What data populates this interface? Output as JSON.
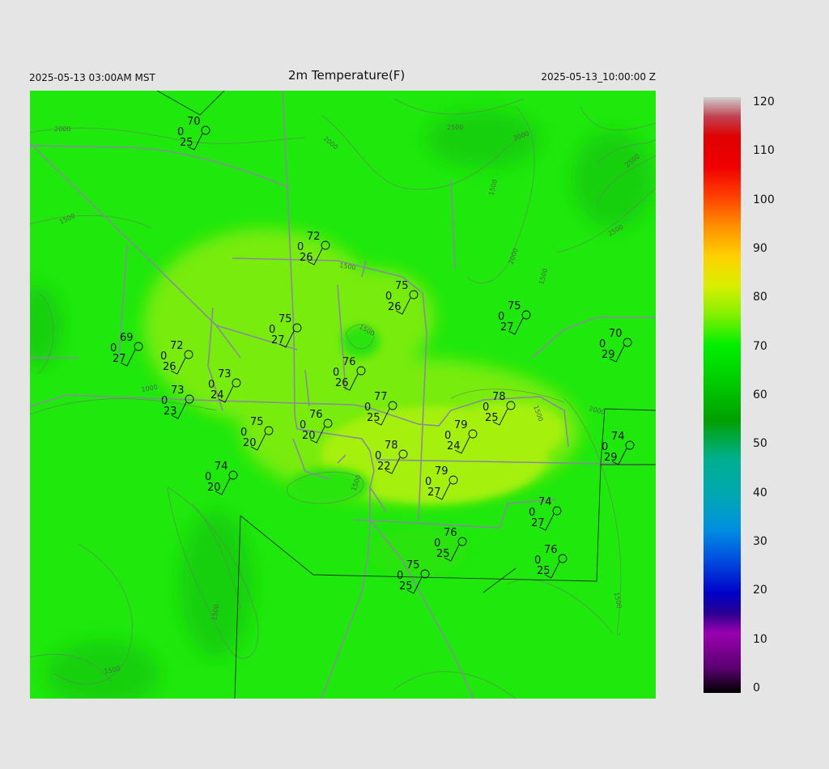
{
  "header": {
    "local_time": "2025-05-13 03:00AM MST",
    "title": "2m Temperature(F)",
    "utc_time": "2025-05-13_10:00:00 Z"
  },
  "colorbar": {
    "labels": [
      "120",
      "110",
      "100",
      "90",
      "80",
      "70",
      "60",
      "50",
      "40",
      "30",
      "20",
      "10",
      "0"
    ],
    "min": 0,
    "max": 120,
    "stops": [
      {
        "v": 0,
        "c": "#000000"
      },
      {
        "v": 5,
        "c": "#5a0070"
      },
      {
        "v": 12,
        "c": "#9a00b0"
      },
      {
        "v": 16,
        "c": "#2a0090"
      },
      {
        "v": 20,
        "c": "#0000c8"
      },
      {
        "v": 27,
        "c": "#0050e0"
      },
      {
        "v": 33,
        "c": "#0090e0"
      },
      {
        "v": 40,
        "c": "#00a8b0"
      },
      {
        "v": 47,
        "c": "#00b090"
      },
      {
        "v": 55,
        "c": "#00a000"
      },
      {
        "v": 62,
        "c": "#00c800"
      },
      {
        "v": 70,
        "c": "#00f000"
      },
      {
        "v": 76,
        "c": "#80f000"
      },
      {
        "v": 82,
        "c": "#d8f000"
      },
      {
        "v": 88,
        "c": "#ffd000"
      },
      {
        "v": 94,
        "c": "#ff9000"
      },
      {
        "v": 100,
        "c": "#ff4000"
      },
      {
        "v": 106,
        "c": "#f00000"
      },
      {
        "v": 112,
        "c": "#e00000"
      },
      {
        "v": 116,
        "c": "#c04050"
      },
      {
        "v": 120,
        "c": "#d0d0d0"
      }
    ]
  },
  "contour_labels": [
    "2000",
    "2000",
    "2500",
    "3000",
    "2500",
    "2500",
    "2000",
    "1500",
    "1500",
    "1500",
    "1500",
    "1000",
    "1500",
    "1500",
    "1500",
    "2000",
    "1500",
    "1500",
    "1500"
  ],
  "stations": [
    {
      "t": "70",
      "td": "25",
      "ws": "0"
    },
    {
      "t": "72",
      "td": "26",
      "ws": "0"
    },
    {
      "t": "75",
      "td": "26",
      "ws": "0"
    },
    {
      "t": "75",
      "td": "27",
      "ws": "0"
    },
    {
      "t": "75",
      "td": "27",
      "ws": "0"
    },
    {
      "t": "69",
      "td": "27",
      "ws": "0"
    },
    {
      "t": "72",
      "td": "26",
      "ws": "0"
    },
    {
      "t": "70",
      "td": "29",
      "ws": "0"
    },
    {
      "t": "76",
      "td": "26",
      "ws": "0"
    },
    {
      "t": "73",
      "td": "24",
      "ws": "0"
    },
    {
      "t": "73",
      "td": "23",
      "ws": "0"
    },
    {
      "t": "77",
      "td": "25",
      "ws": "0"
    },
    {
      "t": "78",
      "td": "25",
      "ws": "0"
    },
    {
      "t": "76",
      "td": "20",
      "ws": "0"
    },
    {
      "t": "75",
      "td": "20",
      "ws": "0"
    },
    {
      "t": "79",
      "td": "24",
      "ws": "0"
    },
    {
      "t": "74",
      "td": "29",
      "ws": "0"
    },
    {
      "t": "78",
      "td": "22",
      "ws": "0"
    },
    {
      "t": "74",
      "td": "20",
      "ws": "0"
    },
    {
      "t": "79",
      "td": "27",
      "ws": "0"
    },
    {
      "t": "74",
      "td": "27",
      "ws": "0"
    },
    {
      "t": "76",
      "td": "25",
      "ws": "0"
    },
    {
      "t": "76",
      "td": "25",
      "ws": "0"
    },
    {
      "t": "75",
      "td": "25",
      "ws": "0"
    }
  ]
}
